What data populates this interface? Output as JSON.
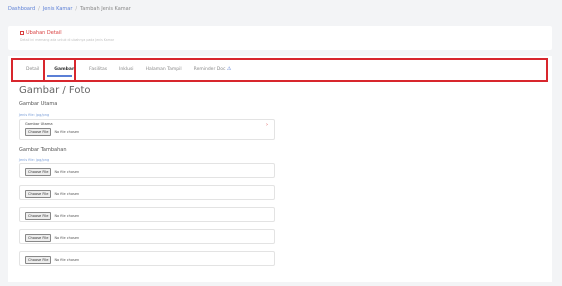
{
  "breadcrumb": {
    "items": [
      "Dashboard",
      "Jenis Kamar",
      "Tambah Jenis Kamar"
    ],
    "separator": "/"
  },
  "alert": {
    "title": "Ubahan Detail",
    "description": "Detail ini memang ada untuk di ubahnya pada Jenis Kamar"
  },
  "tabs": [
    {
      "label": "Detail"
    },
    {
      "label": "Gambar"
    },
    {
      "label": "Fasilitas"
    },
    {
      "label": "Inklusi"
    },
    {
      "label": "Halaman Tampil"
    },
    {
      "label": "Reminder Doc"
    }
  ],
  "tab_warning_icon": "warning-icon",
  "section": {
    "title": "Gambar / Foto",
    "main": {
      "title": "Gambar Utama",
      "hint": "Jenis file: jpg/png",
      "field_label": "Gambar Utama",
      "button": "Choose File",
      "status": "No file chosen"
    },
    "extra": {
      "title": "Gambar Tambahan",
      "hint": "Jenis file: jpg/png",
      "rows": [
        {
          "button": "Choose File",
          "status": "No file chosen"
        },
        {
          "button": "Choose File",
          "status": "No file chosen"
        },
        {
          "button": "Choose File",
          "status": "No file chosen"
        },
        {
          "button": "Choose File",
          "status": "No file chosen"
        },
        {
          "button": "Choose File",
          "status": "No file chosen"
        }
      ]
    }
  },
  "colors": {
    "highlight": "#d8262d",
    "link": "#5b7fd6",
    "alert": "#d94040"
  }
}
